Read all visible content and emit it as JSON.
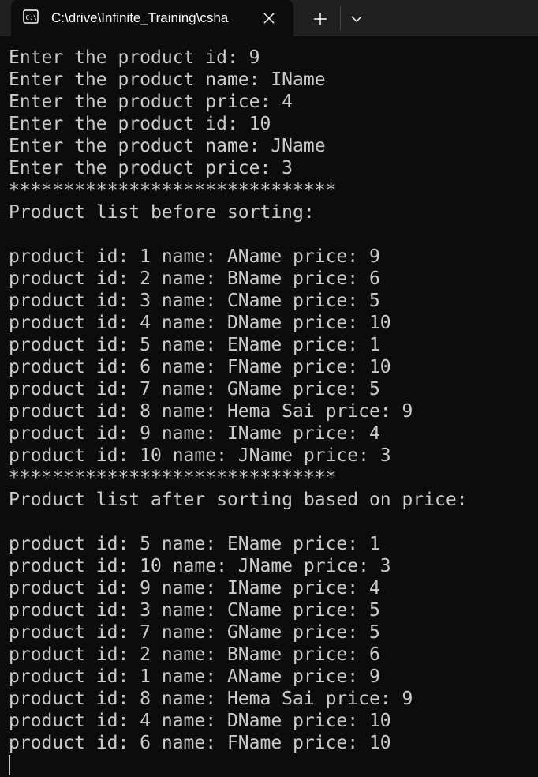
{
  "tab": {
    "icon": "console-icon",
    "title": "C:\\drive\\Infinite_Training\\csha"
  },
  "tabbar": {
    "close_icon": "close-icon",
    "new_tab_icon": "plus-icon",
    "dropdown_icon": "chevron-down-icon"
  },
  "console": {
    "lines": [
      "Enter the product id: 9",
      "Enter the product name: IName",
      "Enter the product price: 4",
      "Enter the product id: 10",
      "Enter the product name: JName",
      "Enter the product price: 3",
      "******************************",
      "Product list before sorting:",
      "",
      "product id: 1 name: AName price: 9",
      "product id: 2 name: BName price: 6",
      "product id: 3 name: CName price: 5",
      "product id: 4 name: DName price: 10",
      "product id: 5 name: EName price: 1",
      "product id: 6 name: FName price: 10",
      "product id: 7 name: GName price: 5",
      "product id: 8 name: Hema Sai price: 9",
      "product id: 9 name: IName price: 4",
      "product id: 10 name: JName price: 3",
      "******************************",
      "Product list after sorting based on price:",
      "",
      "product id: 5 name: EName price: 1",
      "product id: 10 name: JName price: 3",
      "product id: 9 name: IName price: 4",
      "product id: 3 name: CName price: 5",
      "product id: 7 name: GName price: 5",
      "product id: 2 name: BName price: 6",
      "product id: 1 name: AName price: 9",
      "product id: 8 name: Hema Sai price: 9",
      "product id: 4 name: DName price: 10",
      "product id: 6 name: FName price: 10"
    ]
  },
  "colors": {
    "background": "#0c0c0c",
    "tabbar": "#202020",
    "text": "#cccccc"
  }
}
